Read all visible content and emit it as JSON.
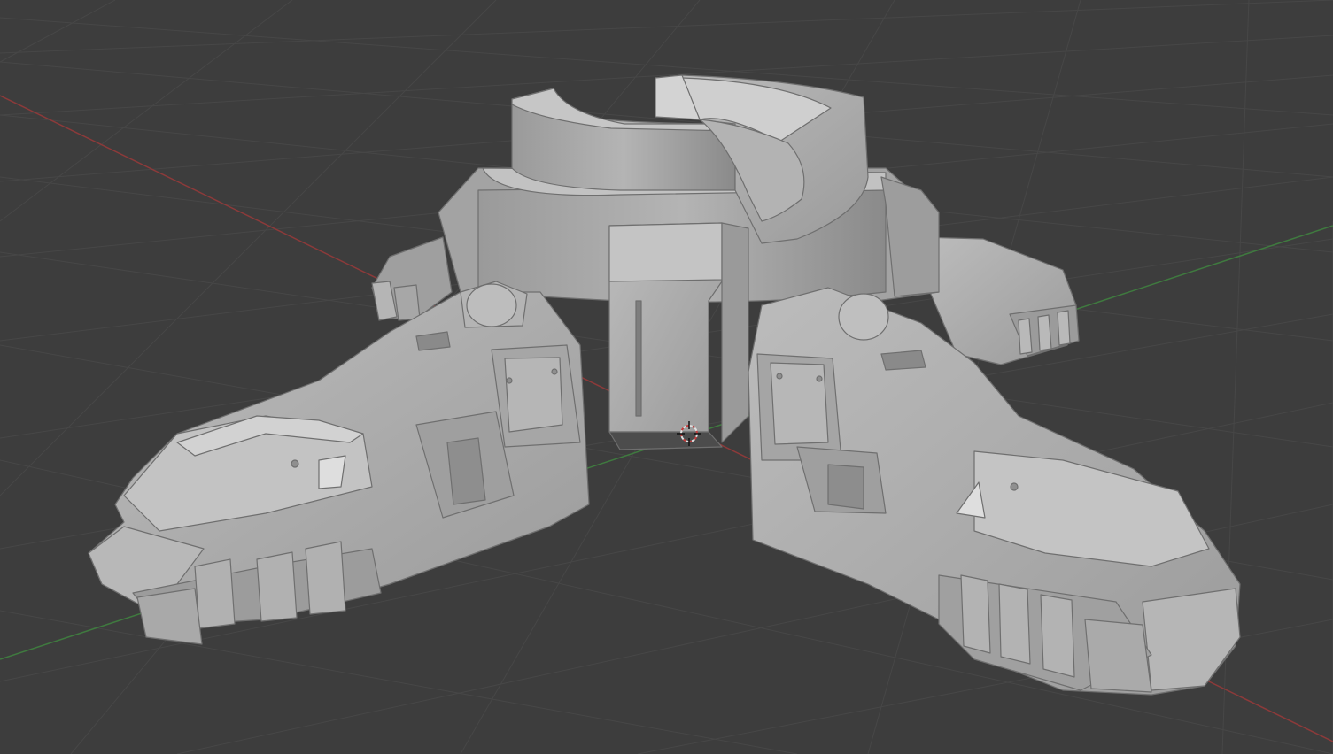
{
  "viewport": {
    "background_color": "#3d3d3d",
    "grid_color": "#4a4a4a",
    "x_axis_color": "#8c3a3a",
    "y_axis_color": "#3f7a3f",
    "model_color": "#a9a9a9",
    "cursor_icon": "3d-cursor-icon"
  }
}
